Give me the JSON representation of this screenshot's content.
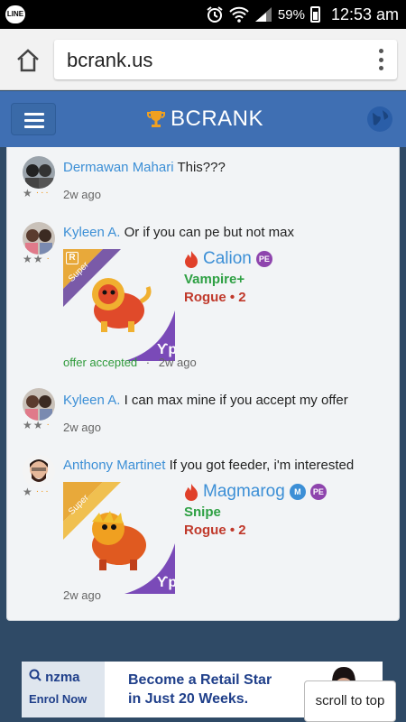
{
  "status": {
    "app_badge": "LINE",
    "battery": "59%",
    "time": "12:53 am"
  },
  "browser": {
    "url": "bcrank.us"
  },
  "site": {
    "logo": "BCRANK"
  },
  "comments": [
    {
      "user": "Dermawan Mahari",
      "text": "This???",
      "time": "2w ago"
    },
    {
      "user": "Kyleen A.",
      "text": "Or if you can pe but not max",
      "card": {
        "rank_badge": "R",
        "ribbon": "Super",
        "name": "Calion",
        "tags": [
          "PE"
        ],
        "type": "Vampire+",
        "class": "Rogue • 2"
      },
      "status": "offer accepted",
      "separator": "·",
      "time": "2w ago"
    },
    {
      "user": "Kyleen A.",
      "text": "I can max mine if you accept my offer",
      "time": "2w ago"
    },
    {
      "user": "Anthony Martinet",
      "text": "If you got feeder, i'm interested",
      "card": {
        "ribbon": "Super",
        "name": "Magmarog",
        "tags": [
          "M",
          "PE"
        ],
        "type": "Snipe",
        "class": "Rogue • 2"
      },
      "time": "2w ago"
    }
  ],
  "ad": {
    "brand": "nzma",
    "cta": "Enrol Now",
    "line1": "Become a Retail Star",
    "line2": "in Just 20 Weeks."
  },
  "scroll_to_top": "scroll to top",
  "colors": {
    "header": "#3f6fb3",
    "link": "#3c8fd6",
    "type_green": "#2ea043",
    "class_red": "#c0392b",
    "pe_purple": "#8e44ad"
  }
}
